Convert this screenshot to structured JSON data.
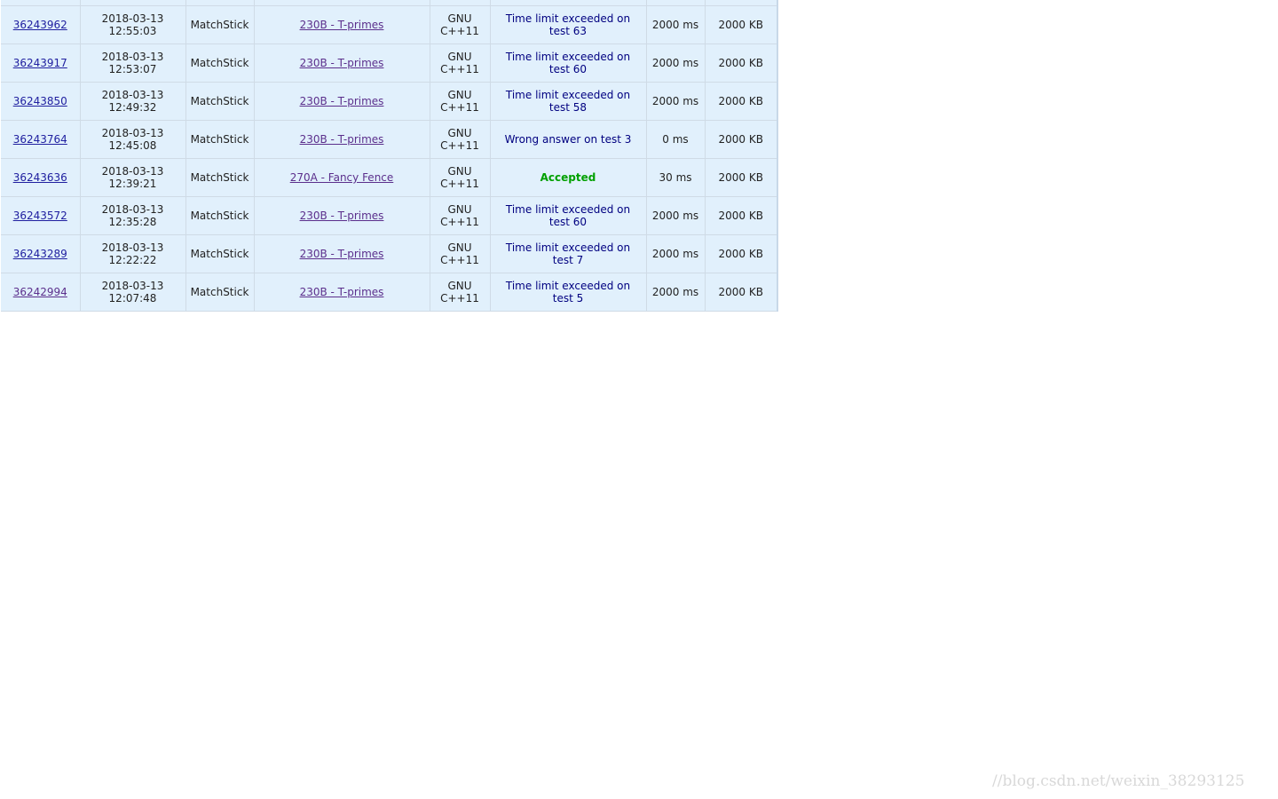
{
  "rows": [
    {
      "id": "36243962",
      "date": "2018-03-13",
      "time": "12:55:03",
      "who": "MatchStick",
      "problem": "230B - T-primes",
      "lang1": "GNU",
      "lang2": "C++11",
      "verdict": "Time limit exceeded on test 63",
      "accepted": false,
      "timeUsed": "2000 ms",
      "memory": "2000 KB"
    },
    {
      "id": "36243917",
      "date": "2018-03-13",
      "time": "12:53:07",
      "who": "MatchStick",
      "problem": "230B - T-primes",
      "lang1": "GNU",
      "lang2": "C++11",
      "verdict": "Time limit exceeded on test 60",
      "accepted": false,
      "timeUsed": "2000 ms",
      "memory": "2000 KB"
    },
    {
      "id": "36243850",
      "date": "2018-03-13",
      "time": "12:49:32",
      "who": "MatchStick",
      "problem": "230B - T-primes",
      "lang1": "GNU",
      "lang2": "C++11",
      "verdict": "Time limit exceeded on test 58",
      "accepted": false,
      "timeUsed": "2000 ms",
      "memory": "2000 KB"
    },
    {
      "id": "36243764",
      "date": "2018-03-13",
      "time": "12:45:08",
      "who": "MatchStick",
      "problem": "230B - T-primes",
      "lang1": "GNU",
      "lang2": "C++11",
      "verdict": "Wrong answer on test 3",
      "accepted": false,
      "timeUsed": "0 ms",
      "memory": "2000 KB"
    },
    {
      "id": "36243636",
      "date": "2018-03-13",
      "time": "12:39:21",
      "who": "MatchStick",
      "problem": "270A - Fancy Fence",
      "lang1": "GNU",
      "lang2": "C++11",
      "verdict": "Accepted",
      "accepted": true,
      "timeUsed": "30 ms",
      "memory": "2000 KB"
    },
    {
      "id": "36243572",
      "date": "2018-03-13",
      "time": "12:35:28",
      "who": "MatchStick",
      "problem": "230B - T-primes",
      "lang1": "GNU",
      "lang2": "C++11",
      "verdict": "Time limit exceeded on test 60",
      "accepted": false,
      "timeUsed": "2000 ms",
      "memory": "2000 KB"
    },
    {
      "id": "36243289",
      "date": "2018-03-13",
      "time": "12:22:22",
      "who": "MatchStick",
      "problem": "230B - T-primes",
      "lang1": "GNU",
      "lang2": "C++11",
      "verdict": "Time limit exceeded on test 7",
      "accepted": false,
      "timeUsed": "2000 ms",
      "memory": "2000 KB"
    },
    {
      "id": "36242994",
      "date": "2018-03-13",
      "time": "12:07:48",
      "who": "MatchStick",
      "problem": "230B - T-primes",
      "lang1": "GNU",
      "lang2": "C++11",
      "verdict": "Time limit exceeded on test 5",
      "accepted": false,
      "timeUsed": "2000 ms",
      "memory": "2000 KB"
    }
  ],
  "watermark": "//blog.csdn.net/weixin_38293125",
  "colors": {
    "rowBackground": "#e1f0fc",
    "accepted": "#00a000",
    "verdict": "#000080",
    "link": "#2020a0"
  }
}
